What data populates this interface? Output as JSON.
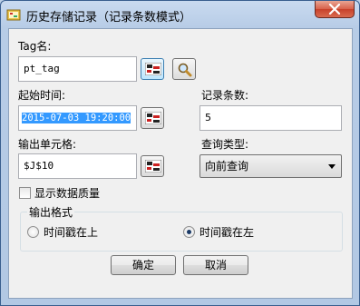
{
  "window": {
    "title": "历史存储记录（记录条数模式）",
    "close_glyph": "✕"
  },
  "form": {
    "tag_label": "Tag名:",
    "tag_value": "pt_tag",
    "start_time_label": "起始时间:",
    "start_time_value": "2015-07-03 19:20:00",
    "record_count_label": "记录条数:",
    "record_count_value": "5",
    "output_cell_label": "输出单元格:",
    "output_cell_value": "$J$10",
    "query_type_label": "查询类型:",
    "query_type_value": "向前查询",
    "show_quality_label": "显示数据质量",
    "show_quality_checked": false
  },
  "output_format": {
    "title": "输出格式",
    "options": [
      {
        "label": "时间戳在上",
        "selected": false
      },
      {
        "label": "时间戳在左",
        "selected": true
      }
    ]
  },
  "buttons": {
    "ok_label": "确定",
    "cancel_label": "取消"
  },
  "icons": {
    "app": "app-icon",
    "picker": "cell-picker-icon",
    "search": "magnifier-icon"
  }
}
